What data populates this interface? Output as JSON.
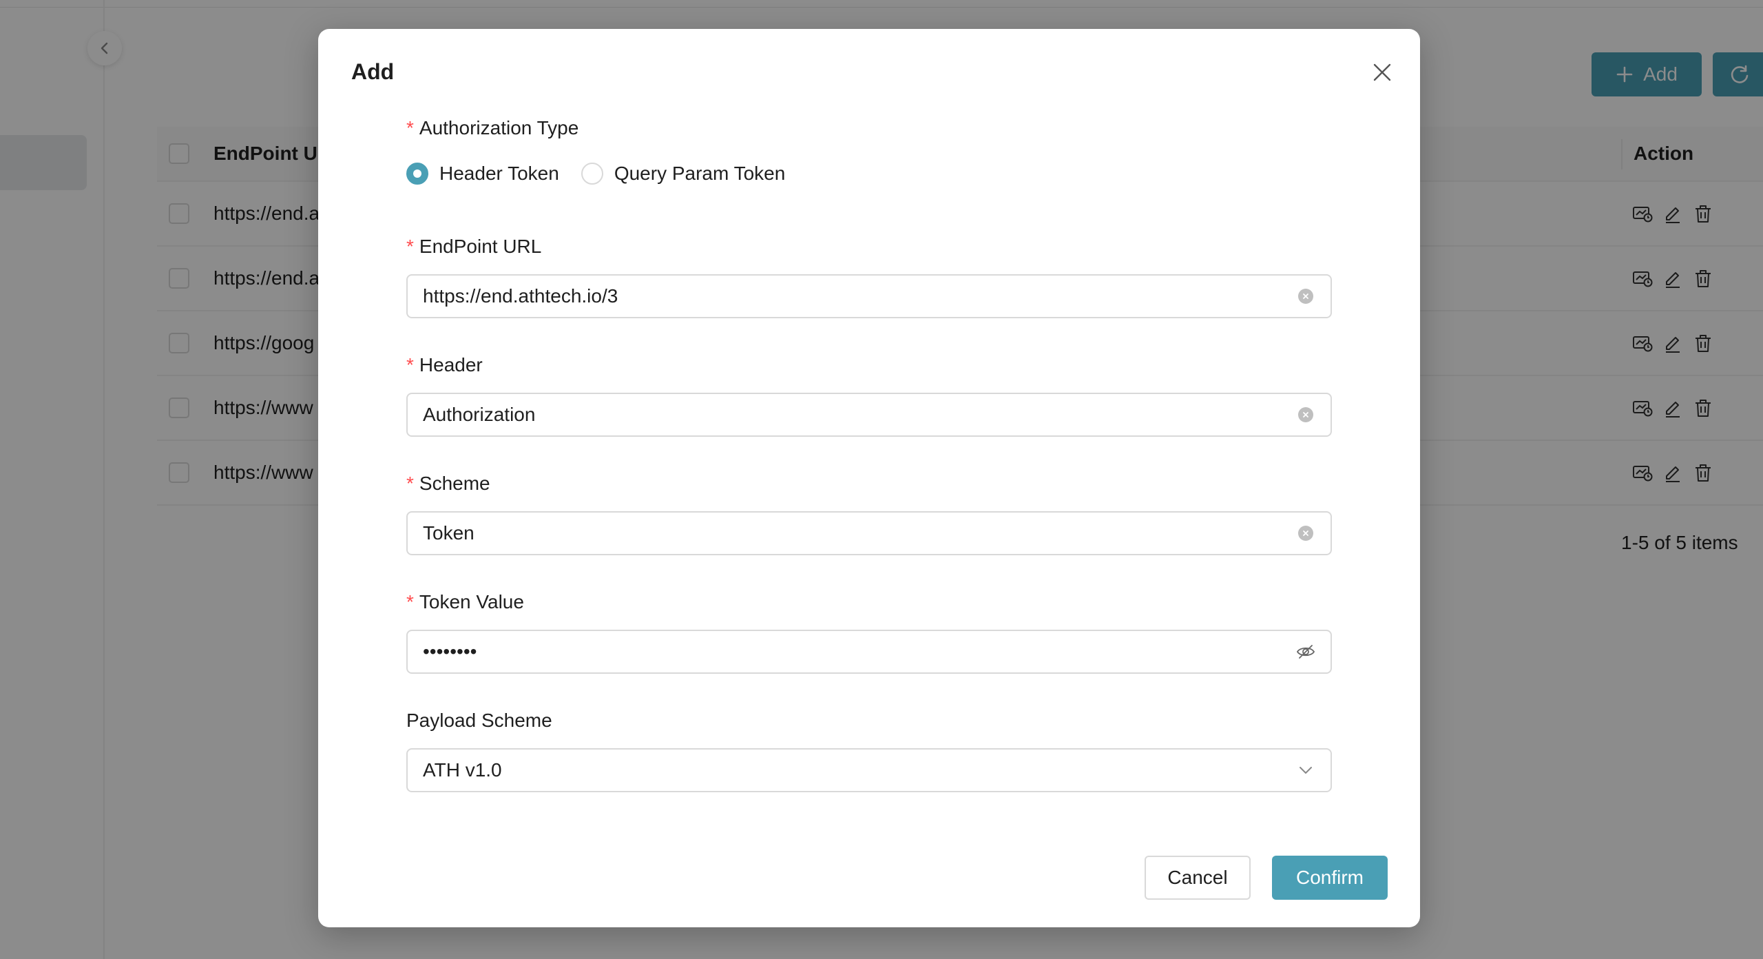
{
  "background": {
    "toolbar": {
      "add_label": "Add",
      "add_icon": "plus-icon",
      "refresh_icon": "refresh-icon"
    },
    "table": {
      "columns": {
        "endpoint_url": "EndPoint Ul",
        "action": "Action"
      },
      "rows": [
        {
          "url": "https://end.a"
        },
        {
          "url": "https://end.a"
        },
        {
          "url": "https://goog"
        },
        {
          "url": "https://www"
        },
        {
          "url": "https://www"
        }
      ],
      "row_action_icons": [
        "test-connection-icon",
        "edit-icon",
        "delete-icon"
      ]
    },
    "pagination": {
      "summary": "1-5 of 5 items"
    }
  },
  "modal": {
    "title": "Add",
    "authorization_type": {
      "label": "Authorization Type",
      "required": true,
      "options": [
        {
          "label": "Header Token",
          "checked": true
        },
        {
          "label": "Query Param Token",
          "checked": false
        }
      ]
    },
    "endpoint_url": {
      "label": "EndPoint URL",
      "required": true,
      "value": "https://end.athtech.io/3"
    },
    "header": {
      "label": "Header",
      "required": true,
      "value": "Authorization"
    },
    "scheme": {
      "label": "Scheme",
      "required": true,
      "value": "Token"
    },
    "token_value": {
      "label": "Token Value",
      "required": true,
      "value": "••••••••"
    },
    "payload_scheme": {
      "label": "Payload Scheme",
      "required": false,
      "value": "ATH v1.0"
    },
    "buttons": {
      "cancel": "Cancel",
      "confirm": "Confirm"
    },
    "required_mark": "*"
  },
  "colors": {
    "primary": "#4a9fb5",
    "required": "#ff4d4f",
    "overlay": "rgba(0,0,0,0.45)"
  }
}
